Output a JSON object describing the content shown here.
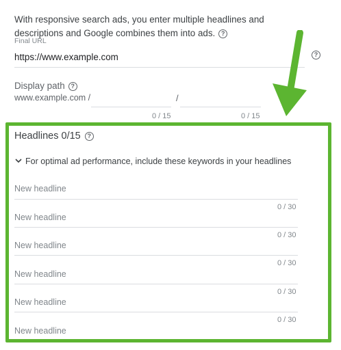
{
  "intro": {
    "text": "With responsive search ads, you enter multiple headlines and descriptions and Google combines them into ads."
  },
  "final_url": {
    "label": "Final URL",
    "value": "https://www.example.com"
  },
  "display_path": {
    "label": "Display path",
    "domain": "www.example.com /",
    "separator": "/",
    "path1_counter": "0 / 15",
    "path2_counter": "0 / 15"
  },
  "headlines": {
    "title": "Headlines 0/15",
    "keywords_hint": "For optimal ad performance, include these keywords in your headlines",
    "placeholder": "New headline",
    "counter": "0 / 30",
    "fields": [
      {
        "placeholder": "New headline",
        "counter": "0 / 30"
      },
      {
        "placeholder": "New headline",
        "counter": "0 / 30"
      },
      {
        "placeholder": "New headline",
        "counter": "0 / 30"
      },
      {
        "placeholder": "New headline",
        "counter": "0 / 30"
      },
      {
        "placeholder": "New headline",
        "counter": "0 / 30"
      },
      {
        "placeholder": "New headline",
        "counter": ""
      }
    ]
  },
  "colors": {
    "highlight": "#5cb531",
    "divider": "#dadce0"
  },
  "icons": [
    "help-icon",
    "chevron-down-icon",
    "arrow-annotation"
  ]
}
